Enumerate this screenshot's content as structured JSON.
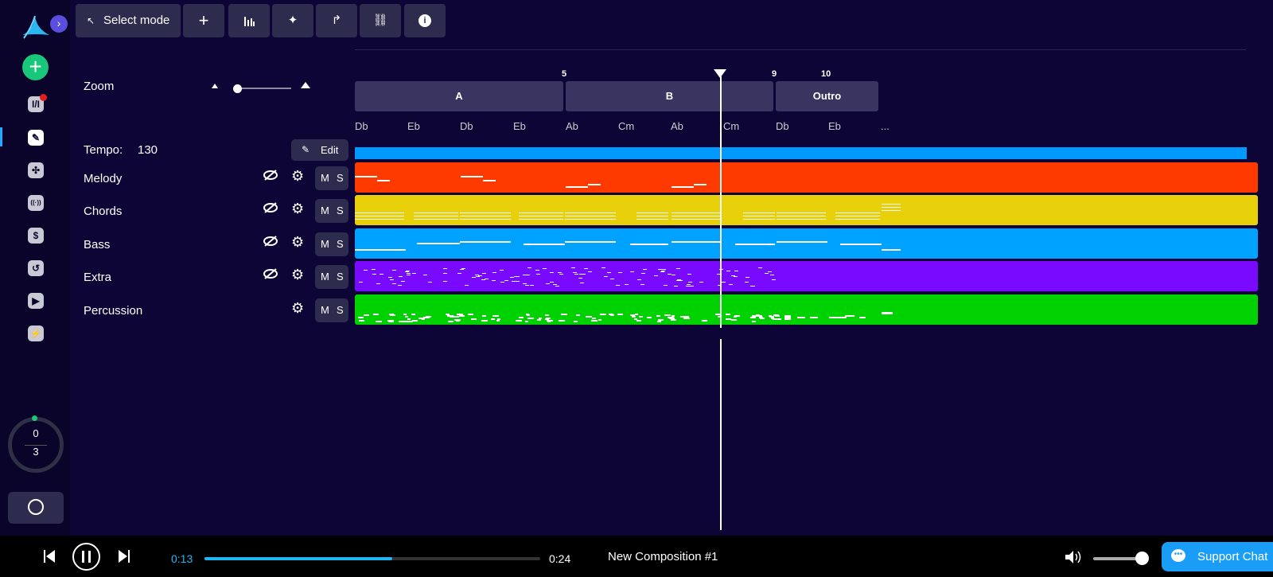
{
  "toolbar": {
    "select_mode_label": "Select mode",
    "add_glyph": "+",
    "mixer_icon": "bars-icon",
    "magic_icon": "magic-wand-icon",
    "share_icon": "share-icon",
    "link_icon": "link-icon",
    "info_glyph": "i"
  },
  "sidebar": {
    "expand_glyph": "›",
    "add_glyph": "+",
    "items": [
      {
        "icon": "mixer-icon",
        "glyph": "I/I"
      },
      {
        "icon": "pencil-icon",
        "glyph": "✎"
      },
      {
        "icon": "shuffle-icon",
        "glyph": "✣"
      },
      {
        "icon": "broadcast-icon",
        "glyph": "((·))"
      },
      {
        "icon": "dollar-icon",
        "glyph": "$"
      },
      {
        "icon": "history-icon",
        "glyph": "↺"
      },
      {
        "icon": "play-icon",
        "glyph": "▶"
      },
      {
        "icon": "bolt-icon",
        "glyph": "⚡"
      }
    ],
    "counter": {
      "top": "0",
      "bottom": "3"
    }
  },
  "zoom": {
    "label": "Zoom",
    "level": 0.05
  },
  "tempo": {
    "label": "Tempo:",
    "value": "130",
    "edit_label": "Edit"
  },
  "tracks": [
    {
      "name": "Melody",
      "color": "#ff3a00",
      "has_visibility": true,
      "mute": "M",
      "solo": "S"
    },
    {
      "name": "Chords",
      "color": "#e8d10b",
      "has_visibility": true,
      "mute": "M",
      "solo": "S"
    },
    {
      "name": "Bass",
      "color": "#00a2ff",
      "has_visibility": true,
      "mute": "M",
      "solo": "S"
    },
    {
      "name": "Extra",
      "color": "#7a0aff",
      "has_visibility": true,
      "mute": "M",
      "solo": "S"
    },
    {
      "name": "Percussion",
      "color": "#00d100",
      "has_visibility": false,
      "mute": "M",
      "solo": "S"
    }
  ],
  "timeline": {
    "bar_numbers": [
      "5",
      "9",
      "10"
    ],
    "sections": [
      "A",
      "B",
      "Outro"
    ],
    "chords": [
      "Db",
      "Eb",
      "Db",
      "Eb",
      "Ab",
      "Cm",
      "Ab",
      "Cm",
      "Db",
      "Eb",
      "..."
    ],
    "tempo_color": "#0099ff"
  },
  "player": {
    "current_time": "0:13",
    "total_time": "0:24",
    "progress": 0.56,
    "title": "New Composition #1",
    "volume": 0.95,
    "support_label": "Support Chat"
  }
}
